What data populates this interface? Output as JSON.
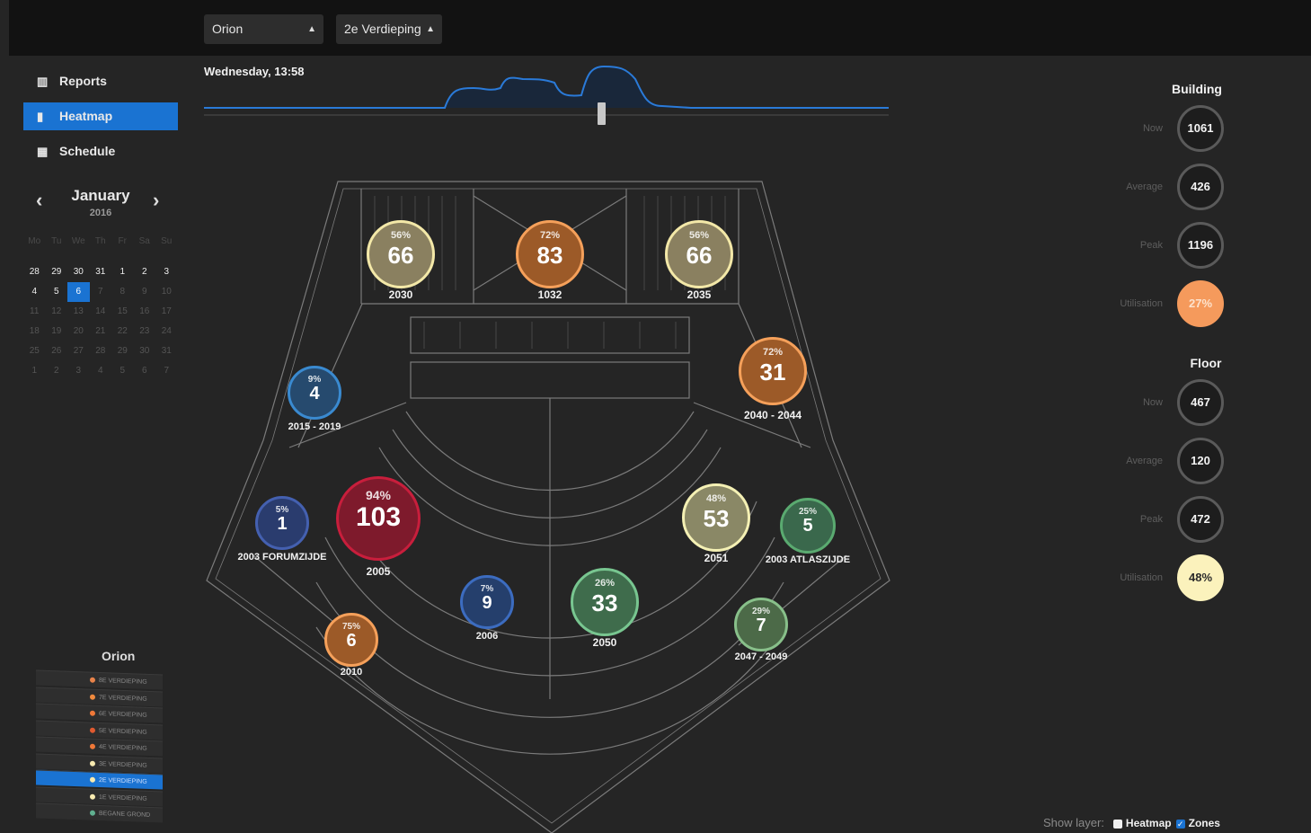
{
  "header": {
    "building_select": "Orion",
    "floor_select": "2e Verdieping"
  },
  "sidebar": {
    "items": [
      {
        "label": "Reports",
        "icon": "bar-chart-icon",
        "active": false
      },
      {
        "label": "Heatmap",
        "icon": "building-icon",
        "active": true
      },
      {
        "label": "Schedule",
        "icon": "calendar-icon",
        "active": false
      }
    ]
  },
  "calendar": {
    "month": "January",
    "year": "2016",
    "weekdays": [
      "Mo",
      "Tu",
      "We",
      "Th",
      "Fr",
      "Sa",
      "Su"
    ],
    "weeks": [
      [
        "28",
        "29",
        "30",
        "31",
        "1",
        "2",
        "3"
      ],
      [
        "4",
        "5",
        "6",
        "7",
        "8",
        "9",
        "10"
      ],
      [
        "11",
        "12",
        "13",
        "14",
        "15",
        "16",
        "17"
      ],
      [
        "18",
        "19",
        "20",
        "21",
        "22",
        "23",
        "24"
      ],
      [
        "25",
        "26",
        "27",
        "28",
        "29",
        "30",
        "31"
      ],
      [
        "1",
        "2",
        "3",
        "4",
        "5",
        "6",
        "7"
      ]
    ],
    "selected": "6"
  },
  "timeline": {
    "label": "Wednesday, 13:58",
    "slider_position": 0.58
  },
  "building": {
    "title": "Building",
    "stats": [
      {
        "label": "Now",
        "value": "1061"
      },
      {
        "label": "Average",
        "value": "426"
      },
      {
        "label": "Peak",
        "value": "1196"
      },
      {
        "label": "Utilisation",
        "value": "27%"
      }
    ]
  },
  "floor": {
    "title": "Floor",
    "stats": [
      {
        "label": "Now",
        "value": "467"
      },
      {
        "label": "Average",
        "value": "120"
      },
      {
        "label": "Peak",
        "value": "472"
      },
      {
        "label": "Utilisation",
        "value": "48%"
      }
    ]
  },
  "zones": [
    {
      "name": "2030",
      "pct": "56%",
      "count": "66",
      "color": "#8a8060",
      "border": "#f3e8a8"
    },
    {
      "name": "1032",
      "pct": "72%",
      "count": "83",
      "color": "#9c5a28",
      "border": "#f5a05a"
    },
    {
      "name": "2035",
      "pct": "56%",
      "count": "66",
      "color": "#8a8060",
      "border": "#f3e8a8"
    },
    {
      "name": "2040 - 2044",
      "pct": "72%",
      "count": "31",
      "color": "#9c5a28",
      "border": "#f5a05a"
    },
    {
      "name": "2015 - 2019",
      "pct": "9%",
      "count": "4",
      "color": "#264a6e",
      "border": "#3a8ad0"
    },
    {
      "name": "2003 FORUMZIJDE",
      "pct": "5%",
      "count": "1",
      "color": "#2a3c6e",
      "border": "#4460b0"
    },
    {
      "name": "2005",
      "pct": "94%",
      "count": "103",
      "color": "#7e1a2c",
      "border": "#c81e3c"
    },
    {
      "name": "2051",
      "pct": "48%",
      "count": "53",
      "color": "#8a8866",
      "border": "#f4f0b4"
    },
    {
      "name": "2003 ATLASZIJDE",
      "pct": "25%",
      "count": "5",
      "color": "#3a684c",
      "border": "#5aaa70"
    },
    {
      "name": "2006",
      "pct": "7%",
      "count": "9",
      "color": "#253f6c",
      "border": "#3c6cc0"
    },
    {
      "name": "2050",
      "pct": "26%",
      "count": "33",
      "color": "#3f6c4c",
      "border": "#78c690"
    },
    {
      "name": "2047 - 2049",
      "pct": "29%",
      "count": "7",
      "color": "#4c6a48",
      "border": "#88c08a"
    },
    {
      "name": "2010",
      "pct": "75%",
      "count": "6",
      "color": "#9c5a28",
      "border": "#f5a05a"
    }
  ],
  "floors": {
    "building_name": "Orion",
    "levels": [
      {
        "label": "8E VERDIEPING",
        "dot": "#e8834a"
      },
      {
        "label": "7E VERDIEPING",
        "dot": "#f08a3e"
      },
      {
        "label": "6E VERDIEPING",
        "dot": "#f07838"
      },
      {
        "label": "5E VERDIEPING",
        "dot": "#e05a30"
      },
      {
        "label": "4E VERDIEPING",
        "dot": "#f07838"
      },
      {
        "label": "3E VERDIEPING",
        "dot": "#f7eab0"
      },
      {
        "label": "2E VERDIEPING",
        "dot": "#f7eab0"
      },
      {
        "label": "1E VERDIEPING",
        "dot": "#f7eab0"
      },
      {
        "label": "BEGANE GROND",
        "dot": "#60b090"
      }
    ]
  },
  "layers": {
    "label": "Show layer:",
    "options": [
      {
        "label": "Heatmap",
        "checked": false
      },
      {
        "label": "Zones",
        "checked": true
      }
    ]
  }
}
